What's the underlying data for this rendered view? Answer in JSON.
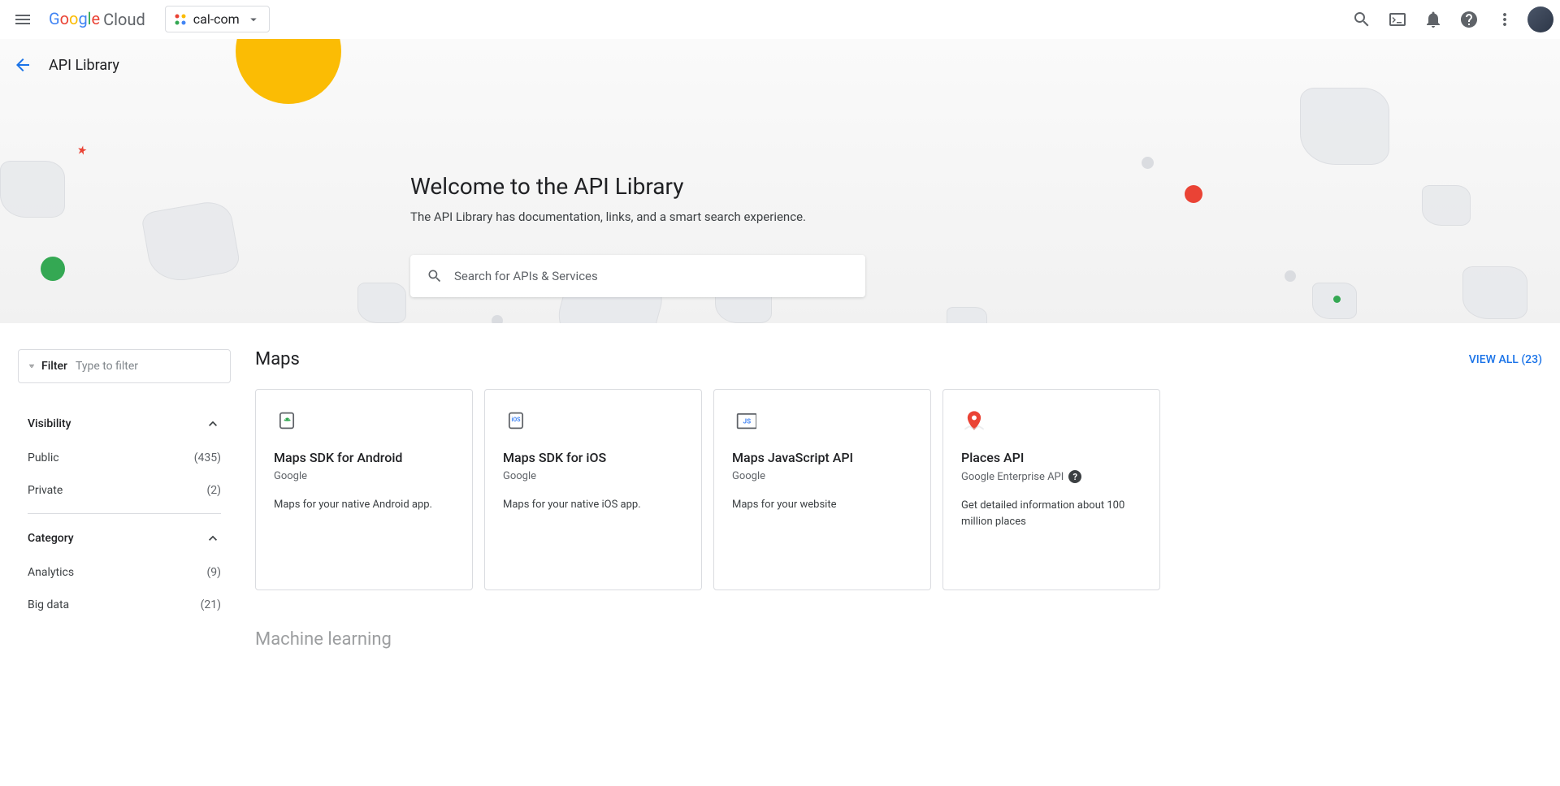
{
  "header": {
    "project_name": "cal-com",
    "page_title": "API Library"
  },
  "hero": {
    "title": "Welcome to the API Library",
    "subtitle": "The API Library has documentation, links, and a smart search experience.",
    "search_placeholder": "Search for APIs & Services"
  },
  "filter": {
    "label": "Filter",
    "placeholder": "Type to filter",
    "groups": [
      {
        "name": "Visibility",
        "items": [
          {
            "label": "Public",
            "count": "(435)"
          },
          {
            "label": "Private",
            "count": "(2)"
          }
        ]
      },
      {
        "name": "Category",
        "items": [
          {
            "label": "Analytics",
            "count": "(9)"
          },
          {
            "label": "Big data",
            "count": "(21)"
          }
        ]
      }
    ]
  },
  "sections": [
    {
      "title": "Maps",
      "view_all": "VIEW ALL (23)",
      "cards": [
        {
          "title": "Maps SDK for Android",
          "provider": "Google",
          "desc": "Maps for your native Android app.",
          "icon": "android"
        },
        {
          "title": "Maps SDK for iOS",
          "provider": "Google",
          "desc": "Maps for your native iOS app.",
          "icon": "ios"
        },
        {
          "title": "Maps JavaScript API",
          "provider": "Google",
          "desc": "Maps for your website",
          "icon": "js"
        },
        {
          "title": "Places API",
          "provider": "Google Enterprise API",
          "desc": "Get detailed information about 100 million places",
          "icon": "places",
          "help": true
        }
      ]
    }
  ],
  "next_section_title": "Machine learning"
}
